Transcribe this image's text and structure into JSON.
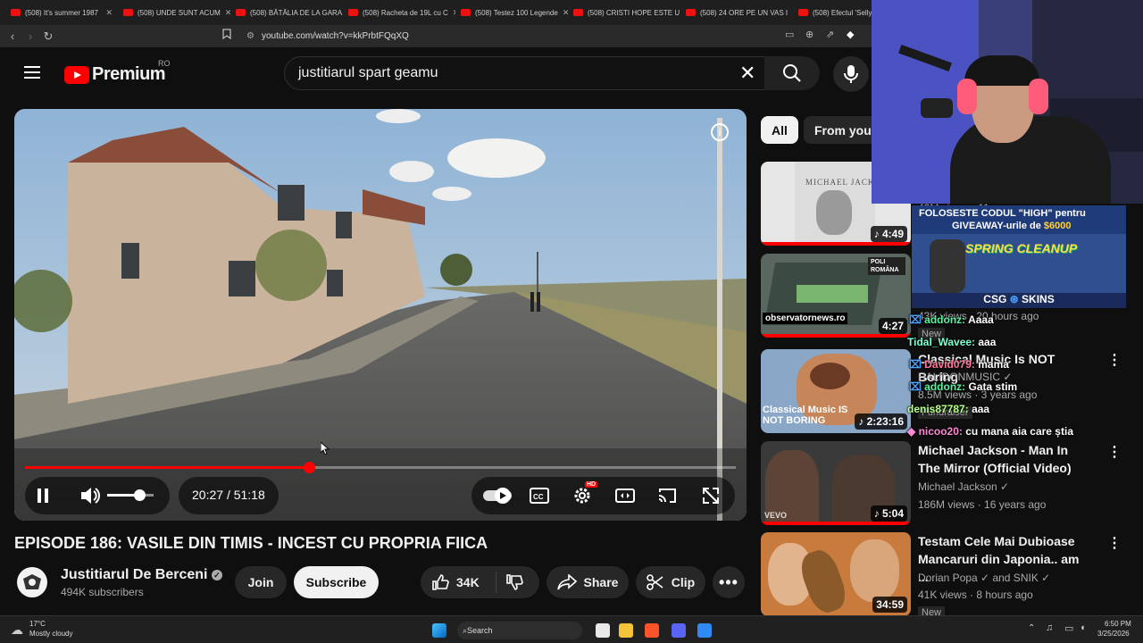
{
  "browser": {
    "tabs": [
      {
        "label": "(508) It's summer 1987"
      },
      {
        "label": "(508) UNDE SUNT ACUM"
      },
      {
        "label": "(508) BĂTĂLIA DE LA GARA"
      },
      {
        "label": "(508) Racheta de 19L cu C"
      },
      {
        "label": "(508) Testez 100 Legende"
      },
      {
        "label": "(508) CRISTI HOPE ESTE U"
      },
      {
        "label": "(508) 24 ORE PE UN VAS I"
      },
      {
        "label": "(508) Efectul 'Selly"
      }
    ],
    "url": "youtube.com/watch?v=kkPrbtFQqXQ"
  },
  "header": {
    "logo_text": "Premium",
    "region": "RO",
    "search_value": "justitiarul spart geamu"
  },
  "player": {
    "current_time": "20:27",
    "separator": "/",
    "duration": "51:18",
    "progress": 0.399,
    "volume": 0.7,
    "hd_badge": "HD"
  },
  "video": {
    "title": "EPISODE 186: VASILE DIN TIMIS - INCEST CU PROPRIA FIICA",
    "channel": "Justitiarul De Berceni",
    "subscribers": "494K subscribers",
    "join_label": "Join",
    "subscribe_label": "Subscribe",
    "likes": "34K",
    "share_label": "Share",
    "clip_label": "Clip"
  },
  "chips": [
    {
      "label": "All"
    },
    {
      "label": "From your"
    }
  ],
  "recommendations": [
    {
      "duration": "4:49",
      "thumb_text": "MICHAEL JACKSON",
      "meta": "42M views · 11 years ago"
    },
    {
      "duration": "4:27",
      "thumb_text": "observatornews.ro",
      "thumb_badge": "POLI ROMÂNA",
      "meta": "43K views · 20 hours ago",
      "badge": "New"
    },
    {
      "duration": "2:23:16",
      "thumb_text": "Classical Music IS NOT BORING",
      "title": "Classical Music Is NOT Boring",
      "channel": "HALIDONMUSIC",
      "meta": "8.5M views · 3 years ago",
      "badge": "Fundraiser"
    },
    {
      "duration": "5:04",
      "thumb_text": "VEVO",
      "title": "Michael Jackson - Man In The Mirror (Official Video)",
      "channel": "Michael Jackson",
      "meta": "186M views · 16 years ago"
    },
    {
      "duration": "34:59",
      "title": "Testam Cele Mai Dubioase Mancaruri din Japonia.. am ...",
      "channel": "Dorian Popa",
      "channel_extra": "and SNIK",
      "meta": "41K views · 8 hours ago",
      "badge": "New"
    }
  ],
  "overlay": {
    "promo_line1": "FOLOSESTE CODUL \"HIGH\" pentru",
    "promo_line2": "GIVEAWAY-urile de",
    "promo_amount": "$6000",
    "banner": "SPRING CLEANUP",
    "brand": "CSG",
    "brand2": "SKINS"
  },
  "chat": [
    {
      "user": "addonz:",
      "msg": "Aaaa"
    },
    {
      "user": "Tidal_Wavee:",
      "msg": "aaa"
    },
    {
      "user": "David079:",
      "msg": "mama"
    },
    {
      "user": "addonz:",
      "msg": "Gata stim"
    },
    {
      "user": "denis87787:",
      "msg": "aaa"
    },
    {
      "user": "nicoo20:",
      "msg": "cu mana aia care știa"
    }
  ],
  "taskbar": {
    "temperature": "17°C",
    "weather": "Mostly cloudy",
    "search_label": "Search",
    "time": "6:50 PM",
    "date": "3/25/2026"
  },
  "colors": {
    "accent": "#ff0000",
    "background": "#0f0f0f"
  }
}
